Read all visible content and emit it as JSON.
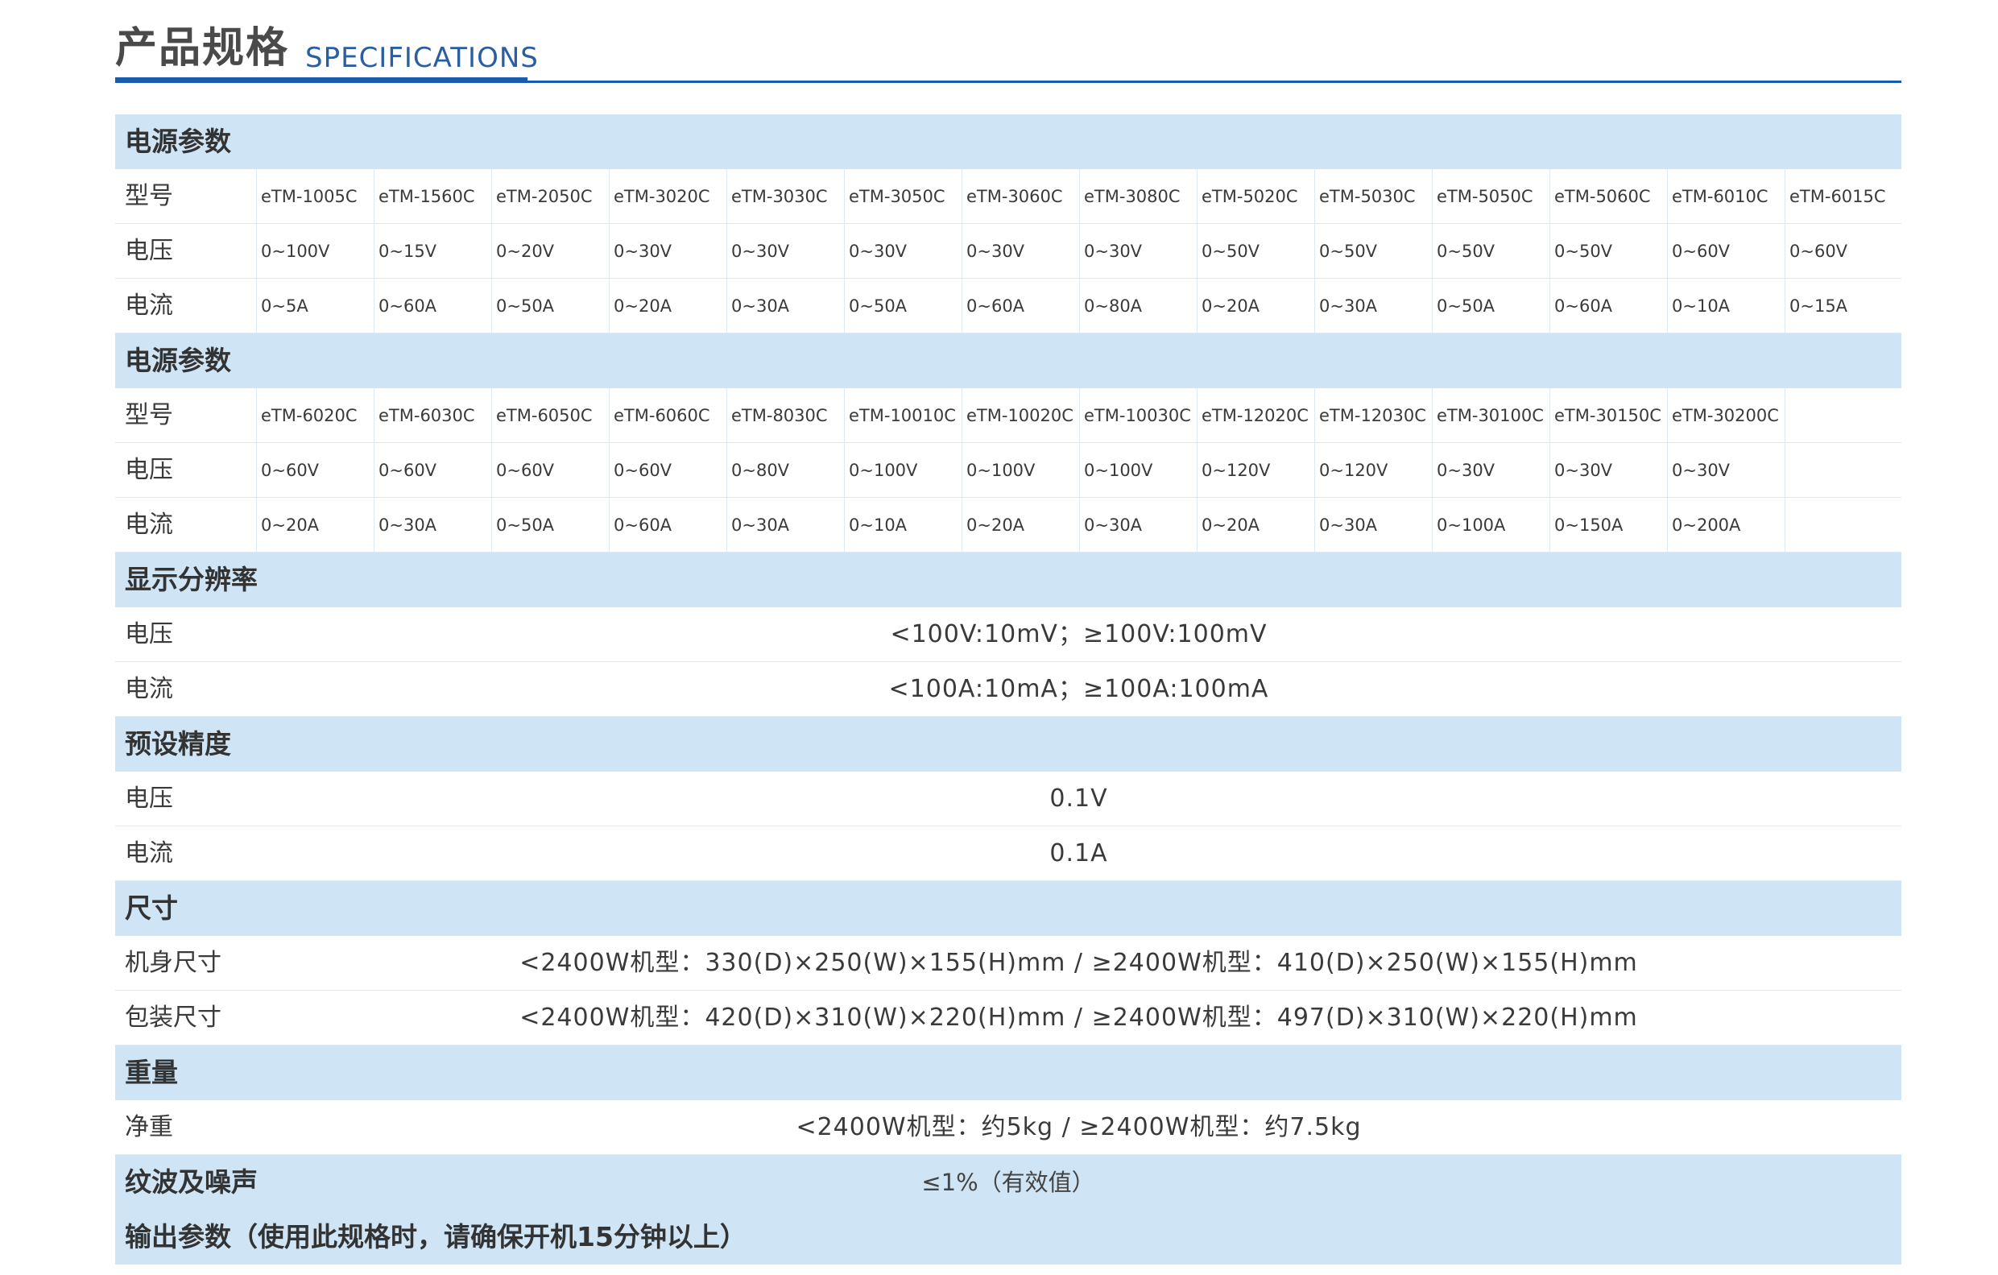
{
  "header": {
    "title_zh": "产品规格",
    "title_en": "SPECIFICATIONS",
    "accent_color": "#1a5bab"
  },
  "power_params_1": {
    "title": "电源参数",
    "rows": [
      {
        "label": "型号",
        "cells": [
          "eTM-1005C",
          "eTM-1560C",
          "eTM-2050C",
          "eTM-3020C",
          "eTM-3030C",
          "eTM-3050C",
          "eTM-3060C",
          "eTM-3080C",
          "eTM-5020C",
          "eTM-5030C",
          "eTM-5050C",
          "eTM-5060C",
          "eTM-6010C",
          "eTM-6015C"
        ]
      },
      {
        "label": "电压",
        "cells": [
          "0~100V",
          "0~15V",
          "0~20V",
          "0~30V",
          "0~30V",
          "0~30V",
          "0~30V",
          "0~30V",
          "0~50V",
          "0~50V",
          "0~50V",
          "0~50V",
          "0~60V",
          "0~60V"
        ]
      },
      {
        "label": "电流",
        "cells": [
          "0~5A",
          "0~60A",
          "0~50A",
          "0~20A",
          "0~30A",
          "0~50A",
          "0~60A",
          "0~80A",
          "0~20A",
          "0~30A",
          "0~50A",
          "0~60A",
          "0~10A",
          "0~15A"
        ]
      }
    ]
  },
  "power_params_2": {
    "title": "电源参数",
    "rows": [
      {
        "label": "型号",
        "cells": [
          "eTM-6020C",
          "eTM-6030C",
          "eTM-6050C",
          "eTM-6060C",
          "eTM-8030C",
          "eTM-10010C",
          "eTM-10020C",
          "eTM-10030C",
          "eTM-12020C",
          "eTM-12030C",
          "eTM-30100C",
          "eTM-30150C",
          "eTM-30200C",
          ""
        ]
      },
      {
        "label": "电压",
        "cells": [
          "0~60V",
          "0~60V",
          "0~60V",
          "0~60V",
          "0~80V",
          "0~100V",
          "0~100V",
          "0~100V",
          "0~120V",
          "0~120V",
          "0~30V",
          "0~30V",
          "0~30V",
          ""
        ]
      },
      {
        "label": "电流",
        "cells": [
          "0~20A",
          "0~30A",
          "0~50A",
          "0~60A",
          "0~30A",
          "0~10A",
          "0~20A",
          "0~30A",
          "0~20A",
          "0~30A",
          "0~100A",
          "0~150A",
          "0~200A",
          ""
        ]
      }
    ]
  },
  "display_resolution": {
    "title": "显示分辨率",
    "voltage_label": "电压",
    "voltage_value": "<100V:10mV；≥100V:100mV",
    "current_label": "电流",
    "current_value": "<100A:10mA；≥100A:100mA"
  },
  "preset_accuracy": {
    "title": "预设精度",
    "voltage_label": "电压",
    "voltage_value": "0.1V",
    "current_label": "电流",
    "current_value": "0.1A"
  },
  "dimensions": {
    "title": "尺寸",
    "body_label": "机身尺寸",
    "body_value": "<2400W机型：330(D)×250(W)×155(H)mm / ≥2400W机型：410(D)×250(W)×155(H)mm",
    "package_label": "包装尺寸",
    "package_value": "<2400W机型：420(D)×310(W)×220(H)mm / ≥2400W机型：497(D)×310(W)×220(H)mm"
  },
  "weight": {
    "title": "重量",
    "net_label": "净重",
    "net_value": "<2400W机型：约5kg /  ≥2400W机型：约7.5kg"
  },
  "ripple": {
    "title": "纹波及噪声",
    "value": "≤1%（有效值）"
  },
  "output_params": {
    "title": "输出参数（使用此规格时，请确保开机15分钟以上）"
  }
}
